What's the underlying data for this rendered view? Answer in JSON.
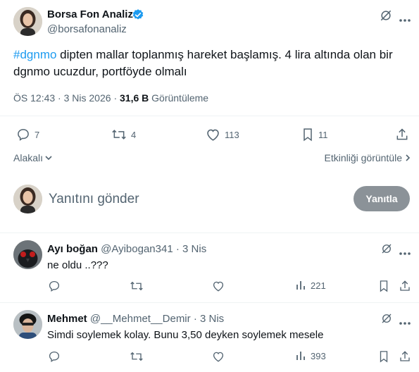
{
  "main_tweet": {
    "author_name": "Borsa Fon Analiz",
    "author_handle": "@borsafonanaliz",
    "hashtag": "#dgnmo",
    "text_line1_rest": " dipten mallar toplanmış hareket başlamış. 4 lira altında olan bir",
    "text_line2": "dgnmo ucuzdur, portföyde olmalı",
    "time": "ÖS 12:43",
    "separator": "·",
    "date": "3 Nis 2026",
    "views_count": "31,6 B",
    "views_label": "Görüntüleme",
    "stats": {
      "replies": "7",
      "retweets": "4",
      "likes": "113",
      "bookmarks": "11"
    }
  },
  "relevance": {
    "label": "Alakalı",
    "engagement_label": "Etkinliği görüntüle"
  },
  "composer": {
    "placeholder": "Yanıtını gönder",
    "button_label": "Yanıtla"
  },
  "replies": [
    {
      "name": "Ayı boğan",
      "handle": "@Ayibogan341",
      "separator": "·",
      "time": "3 Nis",
      "text": "ne oldu ..???",
      "views": "221"
    },
    {
      "name": "Mehmet",
      "handle": "@__Mehmet__Demir",
      "separator": "·",
      "time": "3 Nis",
      "text": "Simdi soylemek kolay. Bunu 3,50 deyken soylemek mesele",
      "views": "393"
    }
  ],
  "colors": {
    "link": "#1d9bf0",
    "verified": "#1d9bf0",
    "muted": "#536471",
    "reply_button": "#8b9298"
  }
}
